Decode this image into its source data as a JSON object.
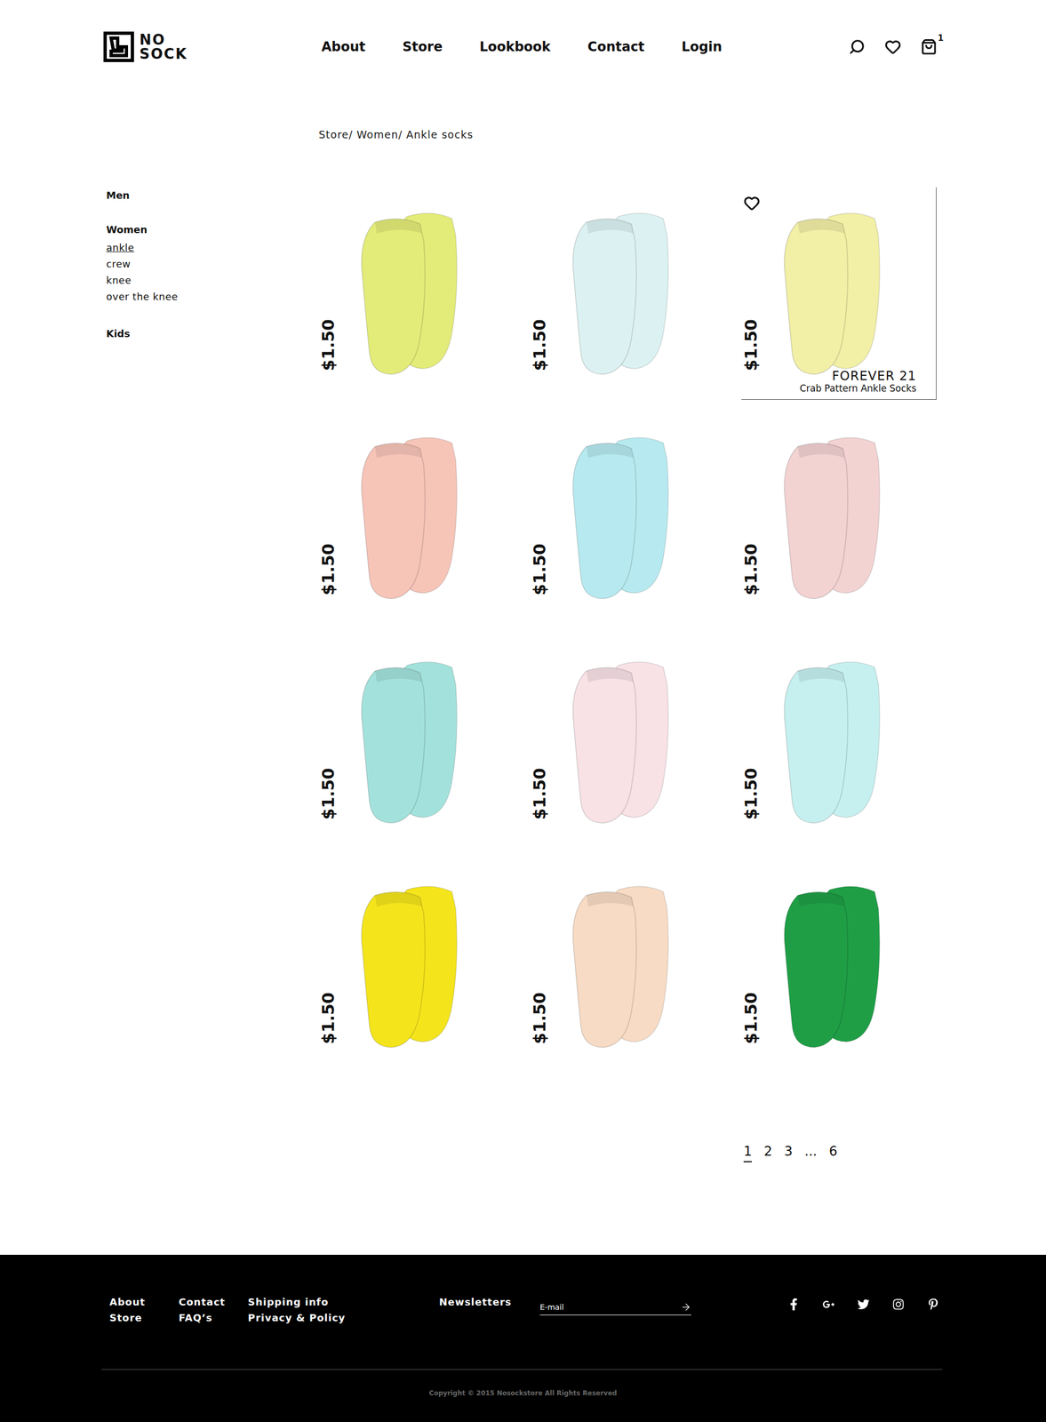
{
  "logo": [
    "NO",
    "SOCK"
  ],
  "nav": [
    "About",
    "Store",
    "Lookbook",
    "Contact",
    "Login"
  ],
  "cart": {
    "count": "1"
  },
  "breadcrumb": "Store/ Women/ Ankle socks",
  "sidebar": {
    "groups": [
      {
        "label": "Men",
        "items": []
      },
      {
        "label": "Women",
        "items": [
          {
            "label": "ankle",
            "selected": true
          },
          {
            "label": "crew",
            "selected": false
          },
          {
            "label": "knee",
            "selected": false
          },
          {
            "label": "over the knee",
            "selected": false
          }
        ]
      },
      {
        "label": "Kids",
        "items": []
      }
    ]
  },
  "products": [
    {
      "price": "$1.50",
      "color": "#e3ec78",
      "hovered": false
    },
    {
      "price": "$1.50",
      "color": "#dcf2f2",
      "hovered": false
    },
    {
      "price": "$1.50",
      "color": "#f2efa6",
      "hovered": true,
      "brand": "FOREVER 21",
      "name": "Crab Pattern Ankle Socks"
    },
    {
      "price": "$1.50",
      "color": "#f7c4b8",
      "hovered": false
    },
    {
      "price": "$1.50",
      "color": "#b6eaf0",
      "hovered": false
    },
    {
      "price": "$1.50",
      "color": "#f3d2d2",
      "hovered": false
    },
    {
      "price": "$1.50",
      "color": "#a3e2dc",
      "hovered": false
    },
    {
      "price": "$1.50",
      "color": "#f8e2e6",
      "hovered": false
    },
    {
      "price": "$1.50",
      "color": "#c6f0f0",
      "hovered": false
    },
    {
      "price": "$1.50",
      "color": "#f4e41c",
      "hovered": false
    },
    {
      "price": "$1.50",
      "color": "#f8dbc4",
      "hovered": false
    },
    {
      "price": "$1.50",
      "color": "#1f9e46",
      "hovered": false
    }
  ],
  "pagination": [
    {
      "label": "1",
      "selected": true
    },
    {
      "label": "2",
      "selected": false
    },
    {
      "label": "3",
      "selected": false
    },
    {
      "label": "...",
      "selected": false
    },
    {
      "label": "6",
      "selected": false
    }
  ],
  "footer": {
    "links": [
      [
        "About",
        "Store"
      ],
      [
        "Contact",
        "FAQ’s"
      ],
      [
        "Shipping info",
        "Privacy & Policy"
      ]
    ],
    "newsletter": {
      "label": "Newsletters",
      "placeholder": "E-mail"
    },
    "copyright": "Copyright © 2015 Nosockstore All Rights Reserved"
  }
}
